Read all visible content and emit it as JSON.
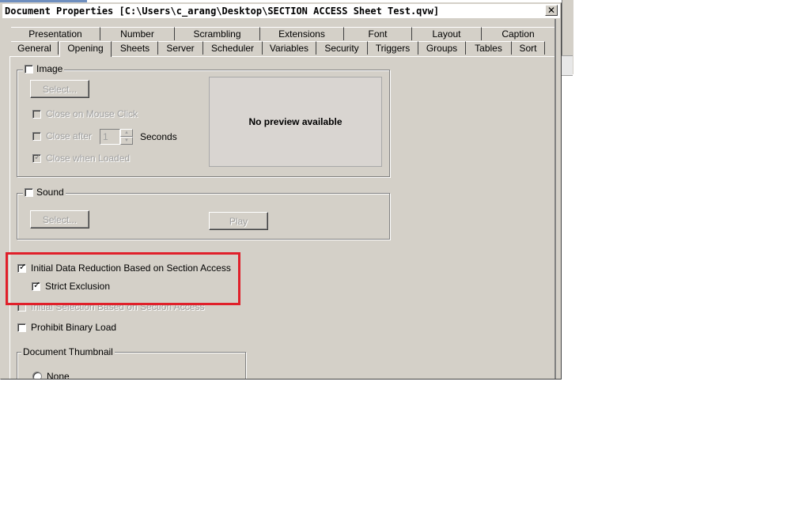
{
  "window": {
    "title": "Document Properties [C:\\Users\\c_arang\\Desktop\\SECTION ACCESS Sheet Test.qvw]",
    "close_glyph": "✕"
  },
  "tabs": {
    "row1": [
      "Presentation",
      "Number",
      "Scrambling",
      "Extensions",
      "Font",
      "Layout",
      "Caption"
    ],
    "row2": [
      "General",
      "Opening",
      "Sheets",
      "Server",
      "Scheduler",
      "Variables",
      "Security",
      "Triggers",
      "Groups",
      "Tables",
      "Sort"
    ],
    "active": "Opening"
  },
  "image_group": {
    "label": "Image",
    "checked": false,
    "select_button": "Select...",
    "close_on_mouse_click": "Close on Mouse Click",
    "close_after": "Close after",
    "close_after_value": "1",
    "seconds": "Seconds",
    "close_when_loaded": "Close when Loaded",
    "preview_text": "No preview available"
  },
  "sound_group": {
    "label": "Sound",
    "checked": false,
    "select_button": "Select...",
    "play_button": "Play"
  },
  "options": {
    "initial_data_reduction": "Initial Data Reduction Based on Section Access",
    "strict_exclusion": "Strict Exclusion",
    "initial_selection": "Initial Selection Based on Section Access",
    "prohibit_binary_load": "Prohibit Binary Load"
  },
  "thumbnail_group": {
    "label": "Document Thumbnail",
    "none_option": "None"
  },
  "colors": {
    "highlight_border": "#e0202a",
    "dialog_face": "#d4d0c8"
  }
}
